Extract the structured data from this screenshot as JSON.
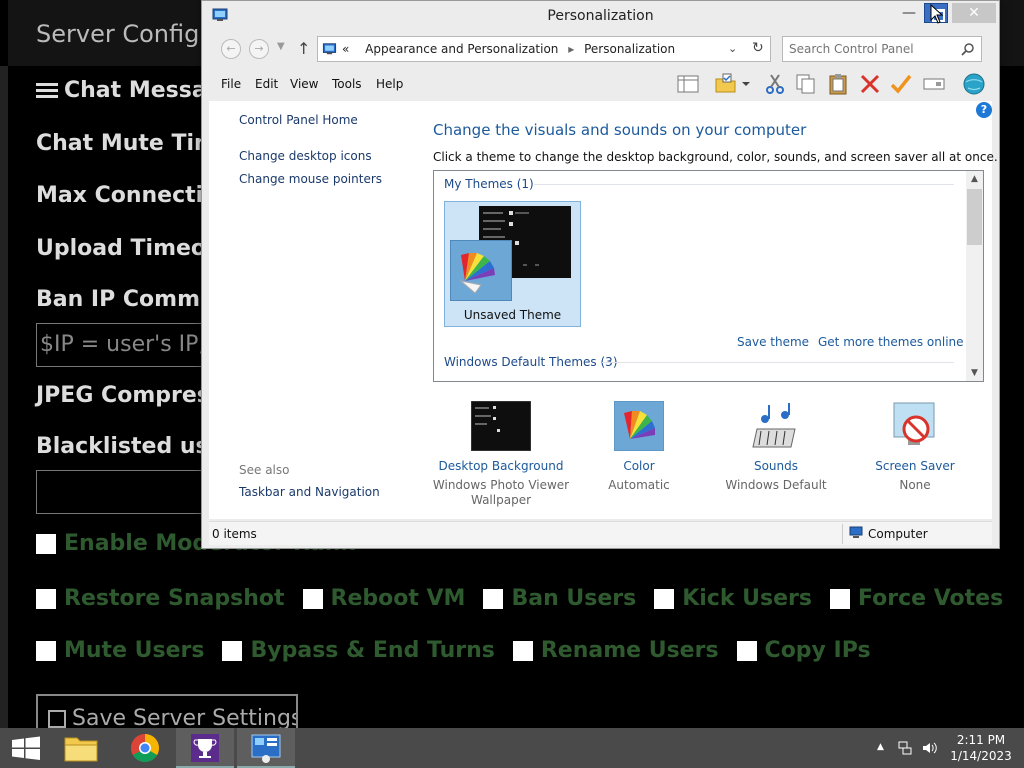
{
  "background_app": {
    "header_title": "Server Configura",
    "labels": [
      "Chat Messag",
      "Chat Mute Tim",
      "Max Connectio",
      "Upload Timeou",
      "Ban IP Comma",
      "JPEG Compres",
      "Blacklisted use"
    ],
    "ban_ip_input_value": "$IP = user's IP, ",
    "checkbox_rows": [
      [
        "Enable Moderator Rank"
      ],
      [
        "Restore Snapshot",
        "Reboot VM",
        "Ban Users",
        "Kick Users",
        "Force Votes"
      ],
      [
        "Mute Users",
        "Bypass & End Turns",
        "Rename Users",
        "Copy IPs"
      ]
    ],
    "save_button": "Save Server Settings"
  },
  "window": {
    "title": "Personalization",
    "close_glyph": "✕",
    "min_glyph": "—",
    "breadcrumb": {
      "prefix": "«",
      "items": [
        "Appearance and Personalization",
        "Personalization"
      ]
    },
    "search_placeholder": "Search Control Panel",
    "menu": [
      "File",
      "Edit",
      "View",
      "Tools",
      "Help"
    ],
    "sidebar": {
      "home": "Control Panel Home",
      "links": [
        "Change desktop icons",
        "Change mouse pointers"
      ],
      "see_also_title": "See also",
      "see_also_links": [
        "Taskbar and Navigation"
      ]
    },
    "main": {
      "heading": "Change the visuals and sounds on your computer",
      "subheading": "Click a theme to change the desktop background, color, sounds, and screen saver all at once.",
      "my_themes_header": "My Themes (1)",
      "selected_theme": "Unsaved Theme",
      "save_theme": "Save theme",
      "get_more_themes": "Get more themes online",
      "default_themes_header": "Windows Default Themes (3)"
    },
    "bottom_items": [
      {
        "title": "Desktop Background",
        "subtitle": "Windows Photo Viewer Wallpaper"
      },
      {
        "title": "Color",
        "subtitle": "Automatic"
      },
      {
        "title": "Sounds",
        "subtitle": "Windows Default"
      },
      {
        "title": "Screen Saver",
        "subtitle": "None"
      }
    ],
    "status": {
      "items": "0 items",
      "location": "Computer"
    }
  },
  "taskbar": {
    "time": "2:11 PM",
    "date": "1/14/2023"
  },
  "colors": {
    "link_blue": "#1c5a9c",
    "selection_blue": "#cde4f6",
    "bg_checkbox_text": "#2f5a2f"
  }
}
